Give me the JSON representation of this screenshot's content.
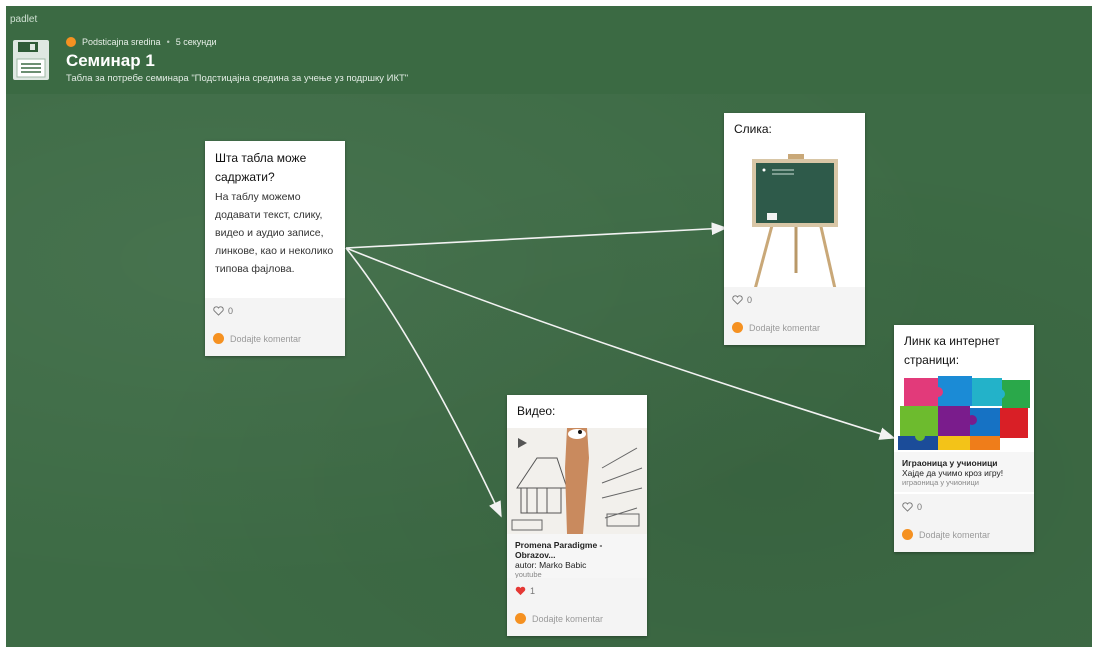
{
  "header": {
    "brand": "padlet",
    "author": "Podsticajna sredina",
    "separator": "•",
    "time_ago": "5 секунди",
    "title": "Семинар 1",
    "subtitle": "Табла за потребе семинара \"Подстицајна средина за учење уз подршку ИКТ\""
  },
  "cards": {
    "text": {
      "title": "Шта табла може садржати?",
      "body": "На таблу можемо додавати текст, слику, видео и аудио записе, линкове, као и неколико типова фајлова.",
      "likes": "0",
      "comment_placeholder": "Dodajte komentar"
    },
    "image": {
      "title": "Слика:",
      "likes": "0",
      "comment_placeholder": "Dodajte komentar"
    },
    "video": {
      "title": "Видео:",
      "link_title": "Promena Paradigme - Obrazov...",
      "link_desc": "autor: Marko Babic",
      "link_source": "youtube",
      "likes": "1",
      "comment_placeholder": "Dodajte komentar"
    },
    "link": {
      "title": "Линк ка интернет страници:",
      "link_title": "Играоница у учионици",
      "link_desc": "Хајде да учимо кроз игру!",
      "link_source": "играоница у учионици",
      "likes": "0",
      "comment_placeholder": "Dodajte komentar"
    }
  },
  "colors": {
    "board": "#3d6b45",
    "accent": "#f59121",
    "heart_liked": "#e53935"
  }
}
